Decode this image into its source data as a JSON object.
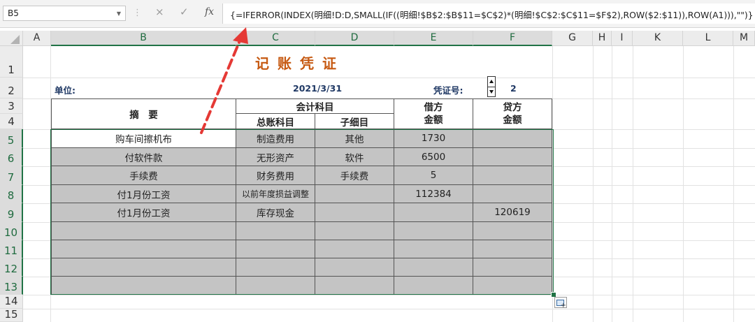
{
  "name_box": "B5",
  "formula_bar": {
    "separator": "⋮",
    "cancel_icon": "×",
    "enter_icon": "✓",
    "fx_label": "fx",
    "formula": "{=IFERROR(INDEX(明细!D:D,SMALL(IF((明细!$B$2:$B$11=$C$2)*(明细!$C$2:$C$11=$F$2),ROW($2:$11)),ROW(A1))),\"\")}"
  },
  "columns": [
    "A",
    "B",
    "C",
    "D",
    "E",
    "F",
    "G",
    "H",
    "I",
    "K",
    "L",
    "M"
  ],
  "rows": [
    "1",
    "2",
    "3",
    "4",
    "5",
    "6",
    "7",
    "8",
    "9",
    "10",
    "11",
    "12",
    "13",
    "14",
    "15"
  ],
  "voucher": {
    "title": "记账凭证",
    "unit_label": "单位:",
    "date": "2021/3/31",
    "voucher_no_label": "凭证号:",
    "voucher_no": "2",
    "headers": {
      "summary": "摘　要",
      "account_subject": "会计科目",
      "general_ledger": "总账科目",
      "sub_account": "子细目",
      "debit_line1": "借方",
      "debit_line2": "金额",
      "credit_line1": "贷方",
      "credit_line2": "金额"
    },
    "entries": [
      {
        "summary": "购车间擦机布",
        "ledger": "制造费用",
        "sub": "其他",
        "debit": "1730",
        "credit": ""
      },
      {
        "summary": "付软件款",
        "ledger": "无形资产",
        "sub": "软件",
        "debit": "6500",
        "credit": ""
      },
      {
        "summary": "手续费",
        "ledger": "财务费用",
        "sub": "手续费",
        "debit": "5",
        "credit": ""
      },
      {
        "summary": "付1月份工资",
        "ledger": "以前年度损益调整",
        "sub": "",
        "debit": "112384",
        "credit": ""
      },
      {
        "summary": "付1月份工资",
        "ledger": "库存现金",
        "sub": "",
        "debit": "",
        "credit": "120619"
      },
      {
        "summary": "",
        "ledger": "",
        "sub": "",
        "debit": "",
        "credit": ""
      },
      {
        "summary": "",
        "ledger": "",
        "sub": "",
        "debit": "",
        "credit": ""
      },
      {
        "summary": "",
        "ledger": "",
        "sub": "",
        "debit": "",
        "credit": ""
      },
      {
        "summary": "",
        "ledger": "",
        "sub": "",
        "debit": "",
        "credit": ""
      }
    ]
  },
  "colors": {
    "title": "#c65911",
    "info_text": "#1f3864",
    "selection": "#217346",
    "cell_fill": "#c4c4c4",
    "arrow": "#e53935"
  },
  "icons": {
    "name_box_dropdown": "chevron-down-icon",
    "spin_button": "spin-button-icon",
    "quick_analysis": "quick-analysis-icon",
    "annotation_arrow": "dashed-arrow-icon"
  }
}
